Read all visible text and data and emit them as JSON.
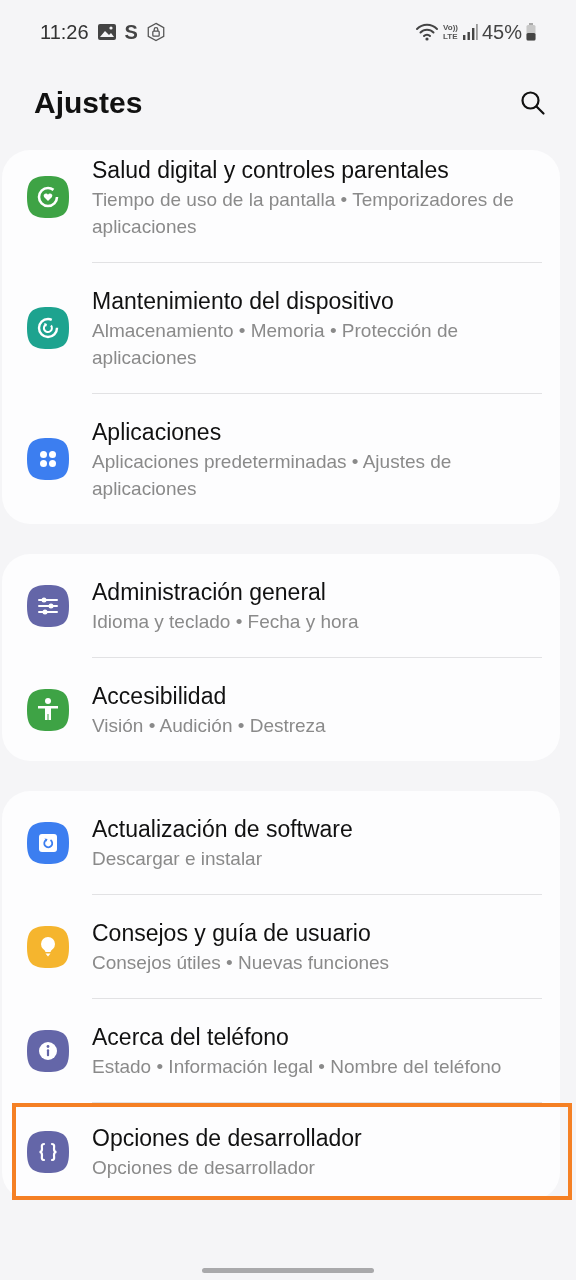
{
  "status_bar": {
    "time": "11:26",
    "app_letter": "S",
    "volte": [
      "Vo))",
      "LTE"
    ],
    "battery": "45%"
  },
  "header": {
    "title": "Ajustes"
  },
  "groups": [
    {
      "items": [
        {
          "title": "Salud digital y controles parentales",
          "subtitle": "Tiempo de uso de la pantalla • Temporizadores de aplicaciones",
          "kind": "heart",
          "color": "#3ea345",
          "highlighted": false
        },
        {
          "title": "Mantenimiento del dispositivo",
          "subtitle": "Almacenamiento • Memoria • Protección de aplicaciones",
          "kind": "refresh",
          "color": "#1da38f",
          "highlighted": false
        },
        {
          "title": "Aplicaciones",
          "subtitle": "Aplicaciones predeterminadas • Ajustes de aplicaciones",
          "kind": "dots",
          "color": "#3c7ef0",
          "highlighted": false
        }
      ]
    },
    {
      "items": [
        {
          "title": "Administración general",
          "subtitle": "Idioma y teclado • Fecha y hora",
          "kind": "sliders",
          "color": "#6466a8",
          "highlighted": false
        },
        {
          "title": "Accesibilidad",
          "subtitle": "Visión • Audición • Destreza",
          "kind": "person",
          "color": "#3ea345",
          "highlighted": false
        }
      ]
    },
    {
      "items": [
        {
          "title": "Actualización de software",
          "subtitle": "Descargar e instalar",
          "kind": "update",
          "color": "#3c7ef0",
          "highlighted": false
        },
        {
          "title": "Consejos y guía de usuario",
          "subtitle": "Consejos útiles • Nuevas funciones",
          "kind": "bulb",
          "color": "#f5b52e",
          "highlighted": false
        },
        {
          "title": "Acerca del teléfono",
          "subtitle": "Estado • Información legal • Nombre del teléfono",
          "kind": "info",
          "color": "#6466a8",
          "highlighted": false
        },
        {
          "title": "Opciones de desarrollador",
          "subtitle": "Opciones de desarrollador",
          "kind": "braces",
          "color": "#6466a8",
          "highlighted": true
        }
      ]
    }
  ]
}
